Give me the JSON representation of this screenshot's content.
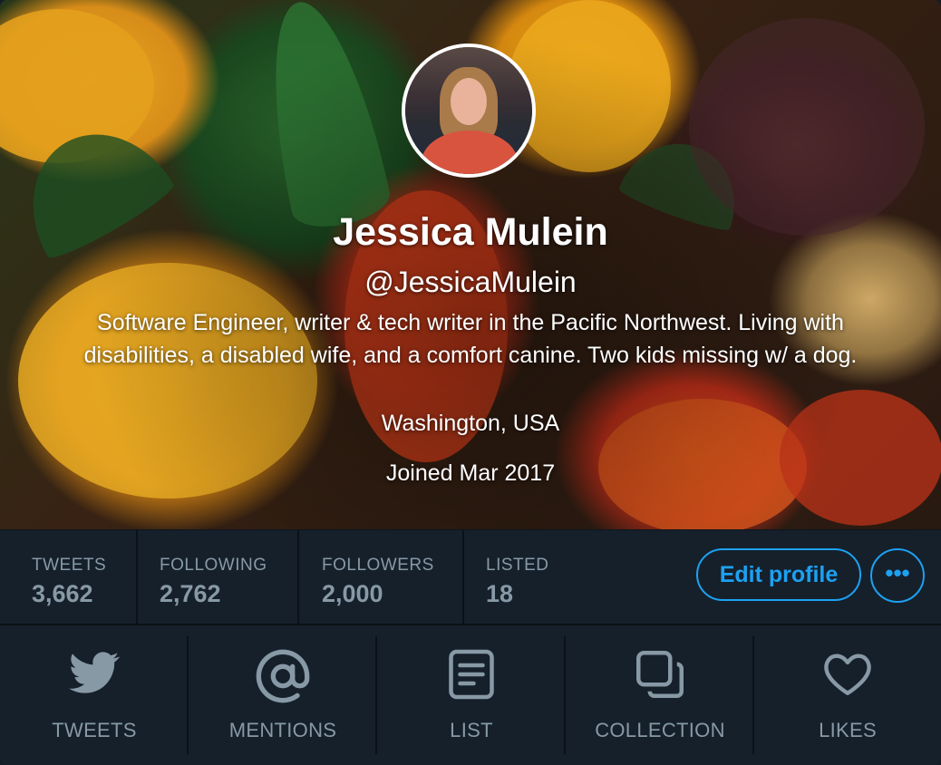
{
  "profile": {
    "name": "Jessica Mulein",
    "handle": "@JessicaMulein",
    "bio": "Software Engineer, writer & tech writer in the Pacific Northwest. Living with disabilities, a disabled wife, and a comfort canine. Two kids missing w/ a dog.",
    "location": "Washington, USA",
    "joined": "Joined Mar 2017"
  },
  "stats": [
    {
      "label": "TWEETS",
      "value": "3,662"
    },
    {
      "label": "FOLLOWING",
      "value": "2,762"
    },
    {
      "label": "FOLLOWERS",
      "value": "2,000"
    },
    {
      "label": "LISTED",
      "value": "18"
    }
  ],
  "actions": {
    "edit_profile": "Edit profile",
    "more": "•••"
  },
  "tabs": [
    {
      "label": "TWEETS",
      "icon": "bird-icon"
    },
    {
      "label": "MENTIONS",
      "icon": "at-icon"
    },
    {
      "label": "LIST",
      "icon": "list-icon"
    },
    {
      "label": "COLLECTION",
      "icon": "collection-icon"
    },
    {
      "label": "LIKES",
      "icon": "heart-icon"
    }
  ],
  "colors": {
    "accent": "#1da1f2",
    "background": "#15202b",
    "muted_text": "#8899a6"
  }
}
